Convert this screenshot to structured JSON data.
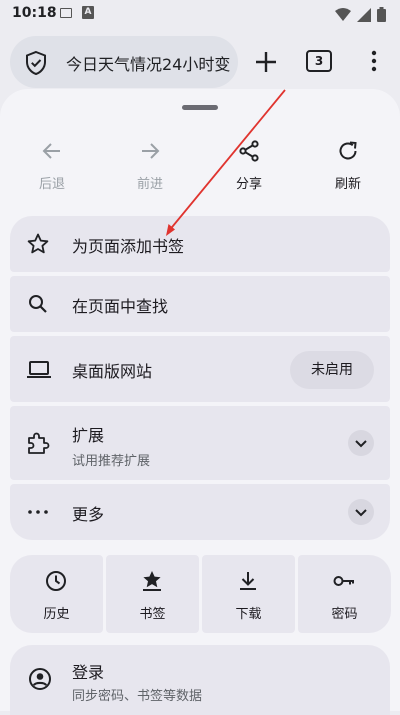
{
  "status_bar": {
    "time": "10:18",
    "a_badge": "A"
  },
  "toolbar": {
    "url_text": "今日天气情况24小时变",
    "tab_count": "3"
  },
  "nav": {
    "back": "后退",
    "forward": "前进",
    "share": "分享",
    "refresh": "刷新"
  },
  "menu": {
    "bookmark_page": "为页面添加书签",
    "find_in_page": "在页面中查找",
    "desktop_site": "桌面版网站",
    "desktop_site_state": "未启用",
    "extensions": "扩展",
    "extensions_sub": "试用推荐扩展",
    "more": "更多"
  },
  "grid": {
    "history": "历史",
    "bookmarks": "书签",
    "downloads": "下载",
    "passwords": "密码"
  },
  "signin": {
    "title": "登录",
    "subtitle": "同步密码、书签等数据"
  }
}
